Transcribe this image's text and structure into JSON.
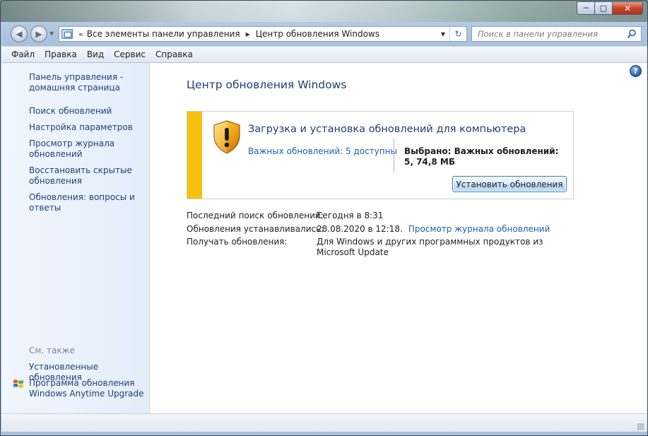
{
  "window": {
    "minimize_glyph": "─",
    "maximize_glyph": "□",
    "close_glyph": "✕"
  },
  "address": {
    "chevron": "«",
    "crumbs": [
      "Все элементы панели управления",
      "Центр обновления Windows"
    ],
    "search_placeholder": "Поиск в панели управления"
  },
  "menu": [
    "Файл",
    "Правка",
    "Вид",
    "Сервис",
    "Справка"
  ],
  "sidebar": {
    "home": "Панель управления - домашняя страница",
    "items": [
      "Поиск обновлений",
      "Настройка параметров",
      "Просмотр журнала обновлений",
      "Восстановить скрытые обновления",
      "Обновления: вопросы и ответы"
    ],
    "see_also": "См. также",
    "installed": "Установленные обновления",
    "anytime": "Программа обновления Windows Anytime Upgrade"
  },
  "main": {
    "help_glyph": "?",
    "title": "Центр обновления Windows",
    "panel": {
      "heading": "Загрузка и установка обновлений для компьютера",
      "important_link": "Важных обновлений: 5 доступны",
      "selected": "Выбрано: Важных обновлений: 5, 74,8 МБ",
      "install_button": "Установить обновления",
      "accent_color": "#f6c00e"
    },
    "info": {
      "last_search_label": "Последний поиск обновлений:",
      "last_search_value": "Сегодня в 8:31",
      "installed_label": "Обновления устанавливались:",
      "installed_value": "28.08.2020 в 12:18.",
      "history_link": "Просмотр журнала обновлений",
      "receive_label": "Получать обновления:",
      "receive_value": "Для Windows и других программных продуктов из Microsoft Update"
    }
  }
}
